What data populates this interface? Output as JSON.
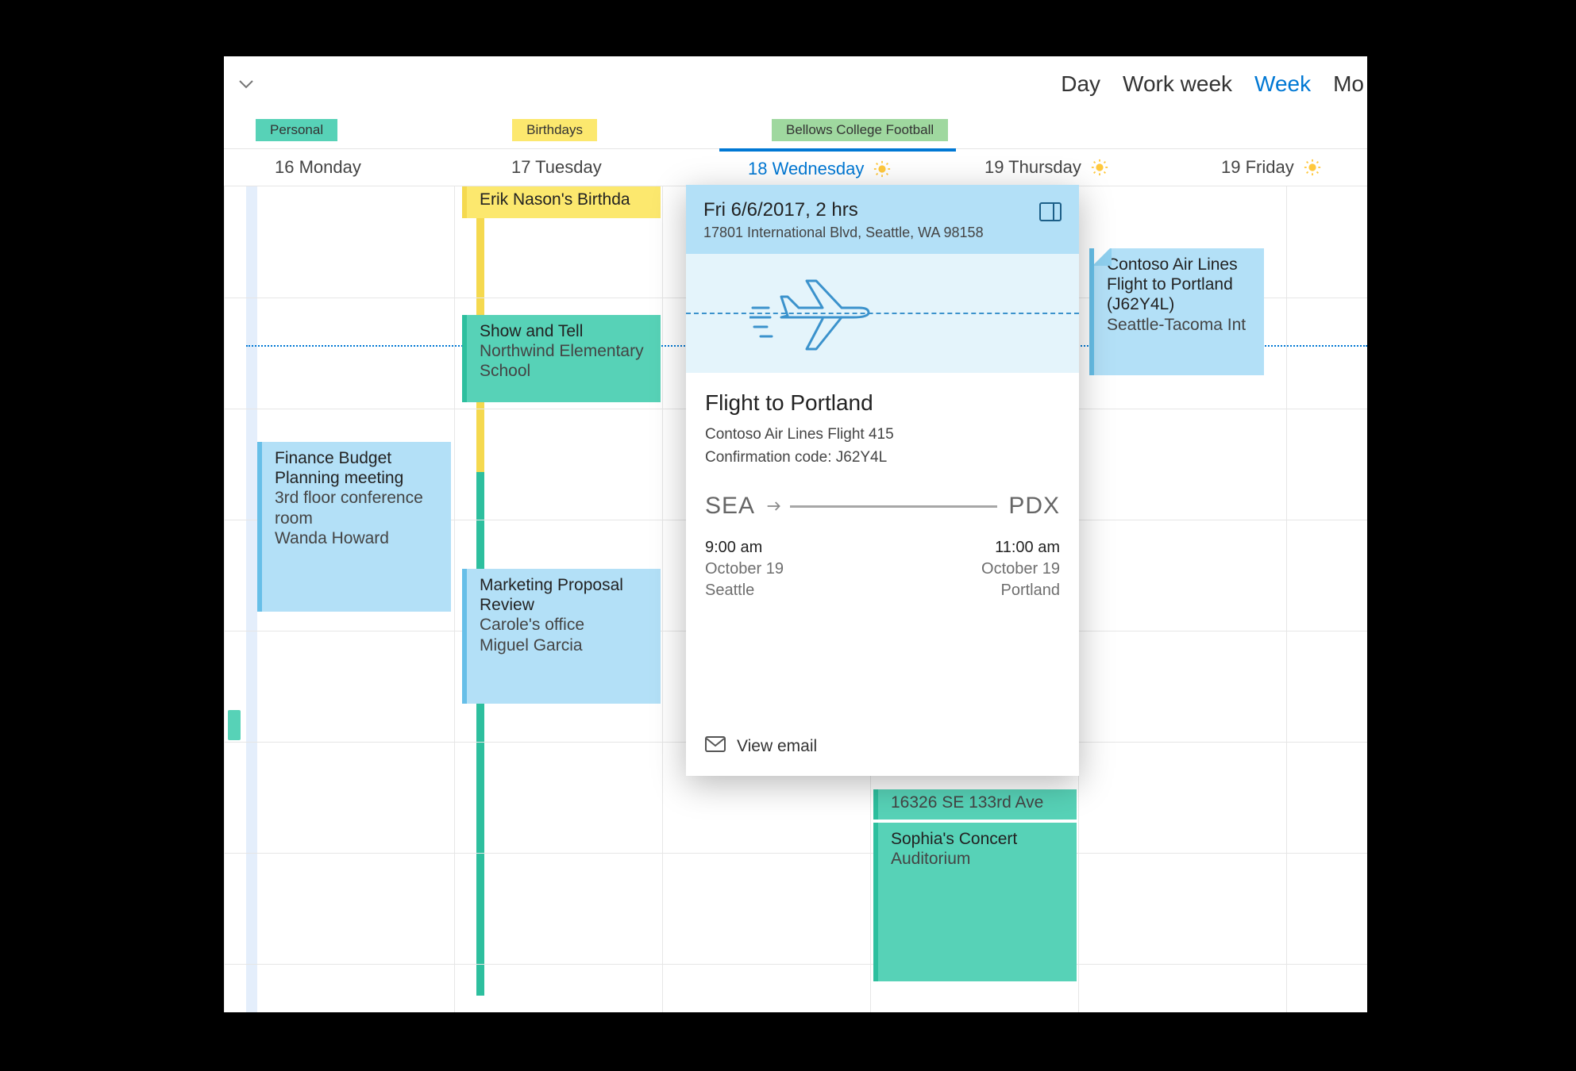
{
  "views": {
    "day": "Day",
    "workweek": "Work week",
    "week": "Week",
    "more": "Mo"
  },
  "calendars": {
    "personal": "Personal",
    "birthdays": "Birthdays",
    "football": "Bellows College Football"
  },
  "days": {
    "mon": "16 Monday",
    "tue": "17 Tuesday",
    "wed": "18 Wednesday",
    "thu": "19 Thursday",
    "fri": "19 Friday"
  },
  "events": {
    "birthday": "Erik Nason's Birthda",
    "showtell": {
      "title": "Show and Tell",
      "loc": "Northwind Elementary School"
    },
    "finance": {
      "title": "Finance Budget Planning meeting",
      "loc": "3rd floor conference room",
      "who": "Wanda Howard"
    },
    "marketing": {
      "title": "Marketing Proposal Review",
      "loc": "Carole's office",
      "who": "Miguel Garcia"
    },
    "addr": "16326 SE 133rd Ave",
    "concert": {
      "title": "Sophia's Concert",
      "loc": "Auditorium"
    },
    "flight": {
      "title": "Contoso Air Lines Flight to Portland (J62Y4L)",
      "loc": "Seattle-Tacoma Int"
    }
  },
  "card": {
    "when": "Fri 6/6/2017, 2 hrs",
    "address": "17801 International Blvd, Seattle, WA 98158",
    "title": "Flight to Portland",
    "airline": "Contoso Air Lines Flight 415",
    "confirmation": "Confirmation code: J62Y4L",
    "dep_code": "SEA",
    "arr_code": "PDX",
    "dep_time": "9:00 am",
    "dep_date": "October 19",
    "dep_city": "Seattle",
    "arr_time": "11:00 am",
    "arr_date": "October 19",
    "arr_city": "Portland",
    "view_email": "View email"
  }
}
